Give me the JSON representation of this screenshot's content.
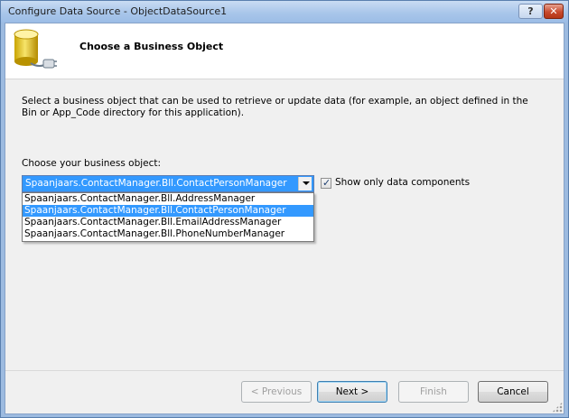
{
  "window": {
    "title": "Configure Data Source - ObjectDataSource1",
    "help_label": "?",
    "close_label": "✕"
  },
  "header": {
    "title": "Choose a Business Object",
    "icon": "database-icon"
  },
  "description": "Select a business object that can be used to retrieve or update data (for example, an object defined in the Bin or App_Code directory for this application).",
  "business_object": {
    "label": "Choose your business object:",
    "selected": "Spaanjaars.ContactManager.Bll.ContactPersonManager",
    "options": [
      "Spaanjaars.ContactManager.Bll.AddressManager",
      "Spaanjaars.ContactManager.Bll.ContactPersonManager",
      "Spaanjaars.ContactManager.Bll.EmailAddressManager",
      "Spaanjaars.ContactManager.Bll.PhoneNumberManager"
    ],
    "highlighted_index": 1
  },
  "show_only_data_components": {
    "label": "Show only data components",
    "checked": true
  },
  "buttons": {
    "previous": "< Previous",
    "next": "Next >",
    "finish": "Finish",
    "cancel": "Cancel"
  },
  "colors": {
    "selection": "#3399ff",
    "title_bar": "#a9c6ea",
    "close_button": "#c84a2e"
  }
}
